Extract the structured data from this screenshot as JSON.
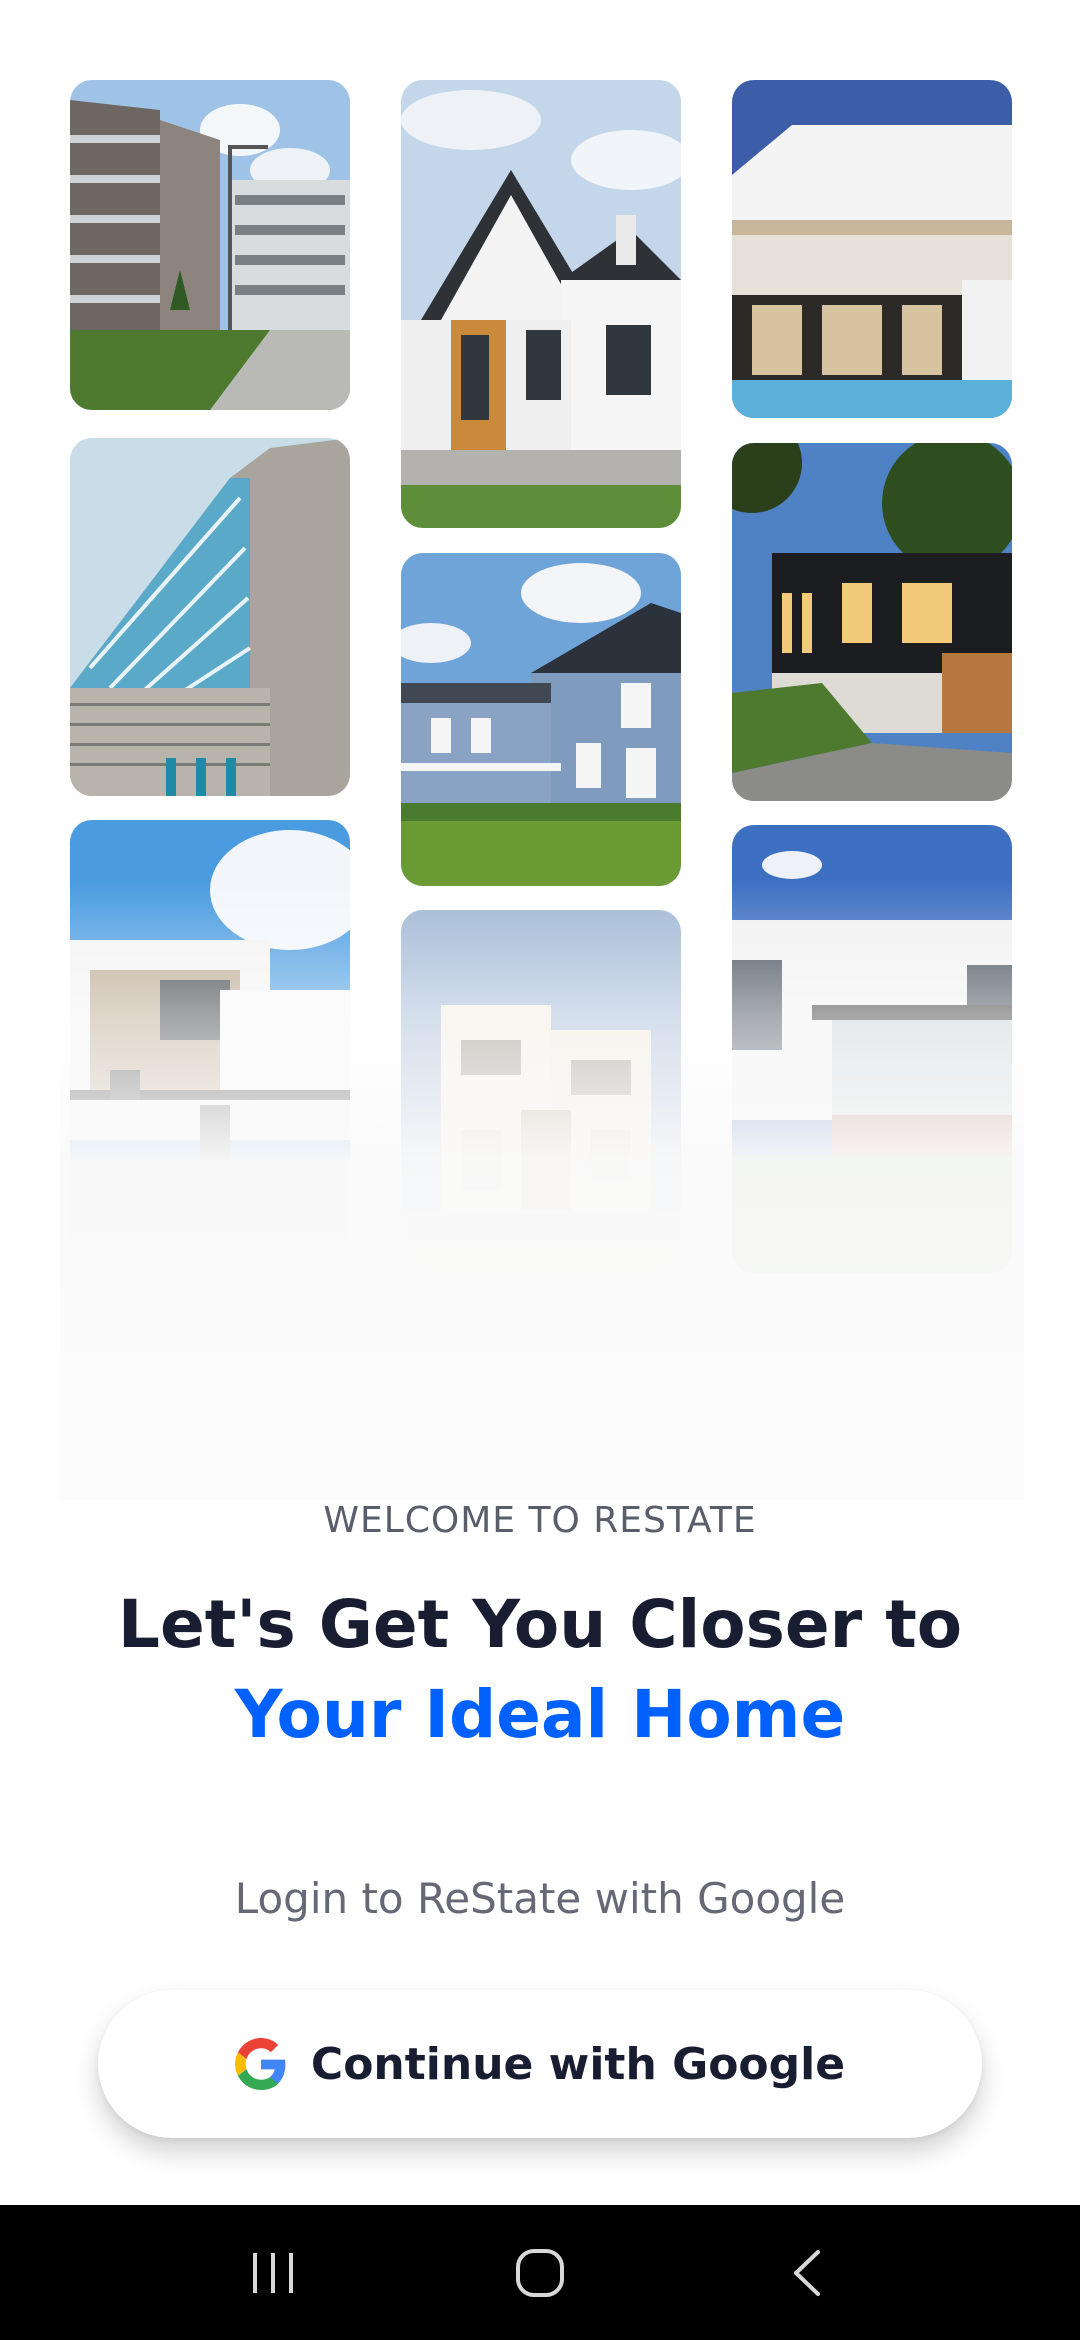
{
  "gallery": {
    "photos": [
      "apartment-complex-photo",
      "angular-facade-photo",
      "modern-white-house-photo",
      "gabled-house-photo",
      "blue-siding-house-photo",
      "cream-townhouse-photo",
      "white-villa-pool-photo",
      "dark-timber-house-photo",
      "flat-roof-house-photo"
    ]
  },
  "welcome": {
    "eyebrow": "WELCOME TO RESTATE",
    "headline_line1": "Let's Get You Closer to",
    "headline_line2": "Your Ideal Home"
  },
  "login": {
    "hint": "Login to ReState with Google",
    "button_label": "Continue with Google",
    "button_icon": "google-icon"
  },
  "navbar": {
    "recents_icon": "recents-icon",
    "home_icon": "home-circle-icon",
    "back_icon": "back-chevron-icon"
  },
  "colors": {
    "headline": "#191d31",
    "accent": "#0061ff",
    "muted": "#666876",
    "navbar": "#000000"
  }
}
